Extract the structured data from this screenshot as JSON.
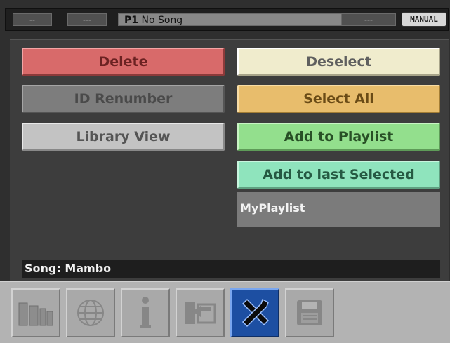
{
  "topbar": {
    "seg1": "--",
    "seg2": "---",
    "player": "P1",
    "song_title": "No Song",
    "seg_right": "---",
    "mode": "MANUAL"
  },
  "actions": {
    "delete": "Delete",
    "id_renumber": "ID Renumber",
    "library_view": "Library View",
    "deselect": "Deselect",
    "select_all": "Select All",
    "add_to_playlist": "Add to Playlist",
    "add_to_last_selected": "Add to last Selected",
    "playlist_name": "MyPlaylist"
  },
  "status": {
    "song_label": "Song: Mambo"
  },
  "toolbar": {
    "icons": [
      "library-icon",
      "globe-icon",
      "info-icon",
      "import-icon",
      "tools-icon",
      "save-icon"
    ],
    "active_icon": "tools-icon"
  },
  "colors": {
    "delete": "#d86a6a",
    "select_all": "#e8bd6c",
    "add_to_playlist": "#93df8d",
    "add_to_last_selected": "#8fe4bd",
    "active_tool": "#1d4fa2"
  }
}
